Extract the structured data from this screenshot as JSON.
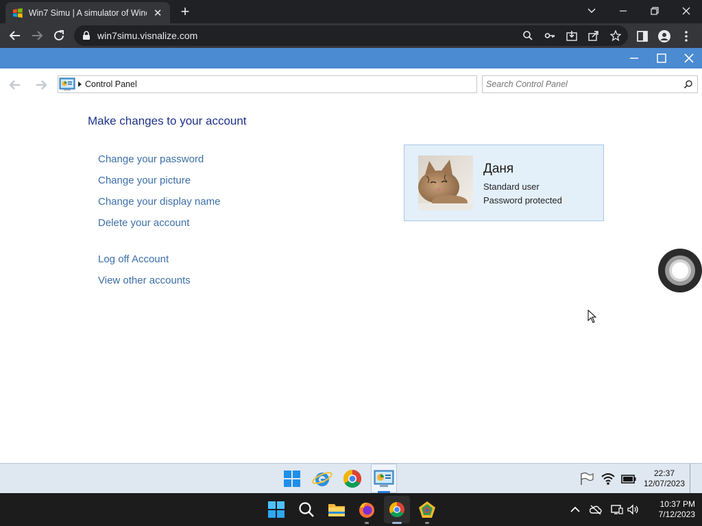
{
  "browser": {
    "tab_title": "Win7 Simu | A simulator of Windows 7",
    "tab_close": "✕",
    "new_tab": "+",
    "url": "win7simu.visnalize.com"
  },
  "window": {
    "breadcrumb": "Control Panel",
    "search_placeholder": "Search Control Panel"
  },
  "page": {
    "heading": "Make changes to your account",
    "tasks": [
      {
        "label": "Change your password"
      },
      {
        "label": "Change your picture"
      },
      {
        "label": "Change your display name"
      },
      {
        "label": "Delete your account"
      },
      {
        "label": "Log off Account"
      },
      {
        "label": "View other accounts"
      }
    ]
  },
  "account": {
    "name": "Даня",
    "type": "Standard user",
    "status": "Password protected"
  },
  "sim_taskbar": {
    "time": "22:37",
    "date": "12/07/2023",
    "pinned": [
      "start-icon",
      "internet-explorer-icon",
      "chrome-icon",
      "control-panel-icon"
    ],
    "tray": [
      "action-center-flag-icon",
      "wifi-icon",
      "battery-icon"
    ]
  },
  "host_taskbar": {
    "time": "10:37 PM",
    "date": "7/12/2023",
    "pinned": [
      "windows-start-icon",
      "search-icon",
      "file-explorer-icon",
      "firefox-icon",
      "chrome-icon",
      "app-icon"
    ]
  },
  "colors": {
    "sim_titlebar": "#4a8bd2",
    "link": "#3c6fa7",
    "heading": "#1e3287",
    "card_bg": "#e3f0fa"
  }
}
